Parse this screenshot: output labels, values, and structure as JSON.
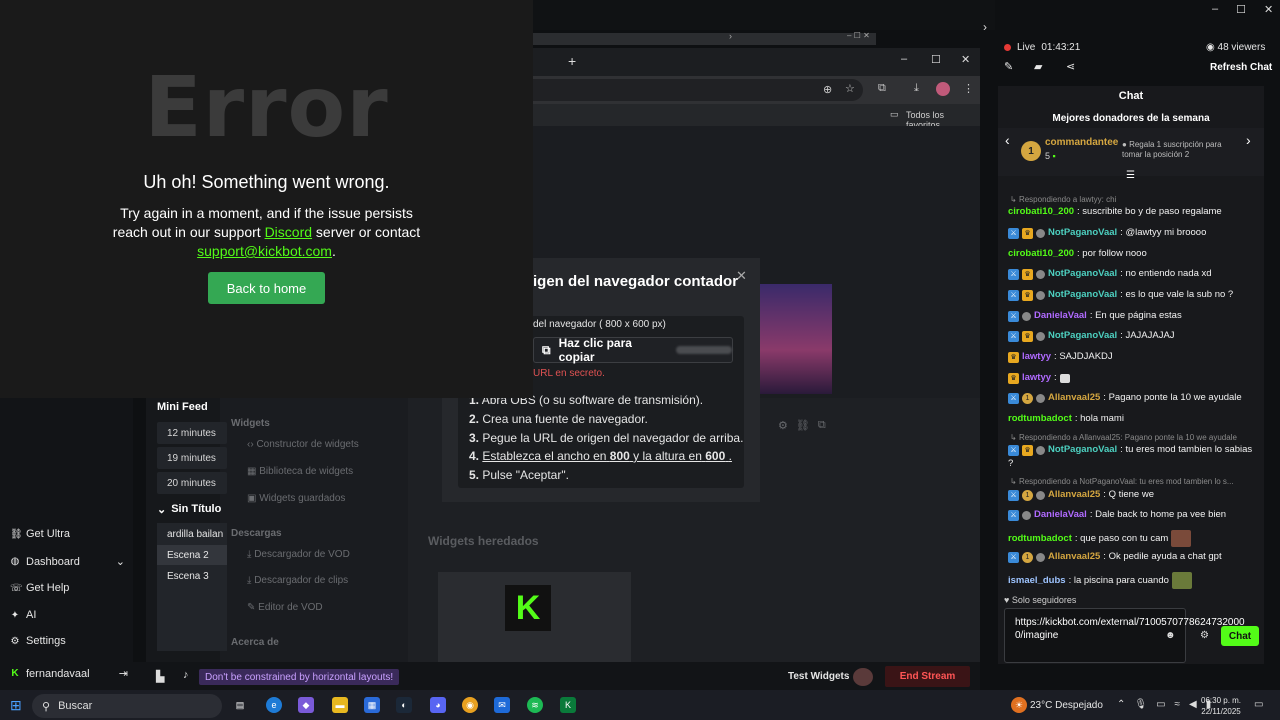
{
  "error": {
    "big": "Error",
    "heading": "Uh oh! Something went wrong.",
    "line1": "Try again in a moment, and if the issue persists reach out in our support",
    "discord": "Discord",
    "line2": "server or contact",
    "email": "support@kickbot.com",
    "dot": ".",
    "button": "Back to home"
  },
  "browser": {
    "bookmarks_label": "Todos los favoritos"
  },
  "modal": {
    "title": "igen del navegador contador",
    "sub": "del navegador ( 800 x 600 px)",
    "copy": "Haz clic para copiar",
    "secret": "URL en secreto.",
    "steps": [
      {
        "num": "1.",
        "text": "Abra OBS (o su software de transmisión)."
      },
      {
        "num": "2.",
        "text": "Crea una fuente de navegador."
      },
      {
        "num": "3.",
        "text": "Pegue la URL de origen del navegador de arriba."
      },
      {
        "num": "5.",
        "text": "Pulse \"Aceptar\"."
      }
    ],
    "step4": {
      "num": "4.",
      "a": "Establezca el ancho en",
      "w": "800",
      "b": "y la altura en",
      "h": "600",
      "end": "."
    }
  },
  "dashboard": {
    "nav": [
      "Get Ultra",
      "Dashboard",
      "Get Help",
      "AI",
      "Settings"
    ],
    "user": "fernandavaal",
    "mini_feed": "Mini Feed",
    "feed": [
      "12 minutes",
      "19 minutes",
      "20 minutes"
    ],
    "sin_titulo": "Sin Título",
    "scenes": [
      "ardilla bailan",
      "Escena 2",
      "Escena 3"
    ],
    "widgets_heading": "Widgets",
    "widgets": [
      "Constructor de widgets",
      "Biblioteca de widgets",
      "Widgets guardados"
    ],
    "descargas": "Descargas",
    "downloads": [
      "Descargador de VOD",
      "Descargador de clips",
      "Editor de VOD"
    ],
    "acerca": "Acerca de",
    "legacy": "Widgets heredados",
    "legacy_logo": "K",
    "tip": "Don't be constrained by horizontal layouts!",
    "test_widgets": "Test Widgets",
    "end_stream": "End Stream"
  },
  "stream": {
    "live": "Live",
    "time": "01:43:21",
    "viewers": "48 viewers",
    "refresh": "Refresh Chat"
  },
  "chat": {
    "title": "Chat",
    "donors_title": "Mejores donadores de la semana",
    "donor_rank": "1",
    "donor_name": "commandantee",
    "donor_count": "5",
    "donor_hint": "Regala 1 suscripción para tomar la posición 2",
    "r1": "Respondiendo a lawtyy: chi",
    "r2": "Respondiendo a Allanvaal25: Pagano ponte la 10 we ayudale",
    "r3": "Respondiendo a NotPaganoVaal: tu eres mod tambien lo s...",
    "messages": [
      {
        "user": "cirobati10_200",
        "text": ": suscribite bo y de paso regalame"
      },
      {
        "user": "NotPaganoVaal",
        "text": ": @lawtyy mi broooo"
      },
      {
        "user": "cirobati10_200",
        "text": ": por follow nooo"
      },
      {
        "user": "NotPaganoVaal",
        "text": ": no entiendo nada xd"
      },
      {
        "user": "NotPaganoVaal",
        "text": ": es lo que vale la sub no ?"
      },
      {
        "user": "DanielaVaal",
        "text": ": En que página estas"
      },
      {
        "user": "NotPaganoVaal",
        "text": ": JAJAJAJAJ"
      },
      {
        "user": "lawtyy",
        "text": ": SAJDJAKDJ"
      },
      {
        "user": "lawtyy",
        "text": ":"
      },
      {
        "user": "Allanvaal25",
        "text": ": Pagano ponte la 10 we ayudale"
      },
      {
        "user": "rodtumbadoct",
        "text": ": hola mami"
      },
      {
        "user": "NotPaganoVaal",
        "text": ": tu eres mod tambien lo sabias"
      },
      {
        "user": "Allanvaal25",
        "text": ": Q tiene we"
      },
      {
        "user": "DanielaVaal",
        "text": ": Dale back to home pa vee bien"
      },
      {
        "user": "rodtumbadoct",
        "text": ": que paso con tu cam"
      },
      {
        "user": "Allanvaal25",
        "text": ": Ok pedile ayuda a chat gpt"
      },
      {
        "user": "ismael_dubs",
        "text": ": la piscina para cuando"
      }
    ],
    "wrap_q": "?",
    "followers_only": "Solo seguidores",
    "input_value": "https://kickbot.com/external/7100570778624732000 0/imagine",
    "send": "Chat"
  },
  "taskbar": {
    "search": "Buscar",
    "weather": "23°C  Despejado",
    "time": "06:30 p. m.",
    "date": "22/11/2025"
  },
  "colors": {
    "kick_green": "#53fc18",
    "mod_blue": "#3a8ad8",
    "vip_gold": "#e8a820",
    "end_stream_red": "#ff5555"
  }
}
